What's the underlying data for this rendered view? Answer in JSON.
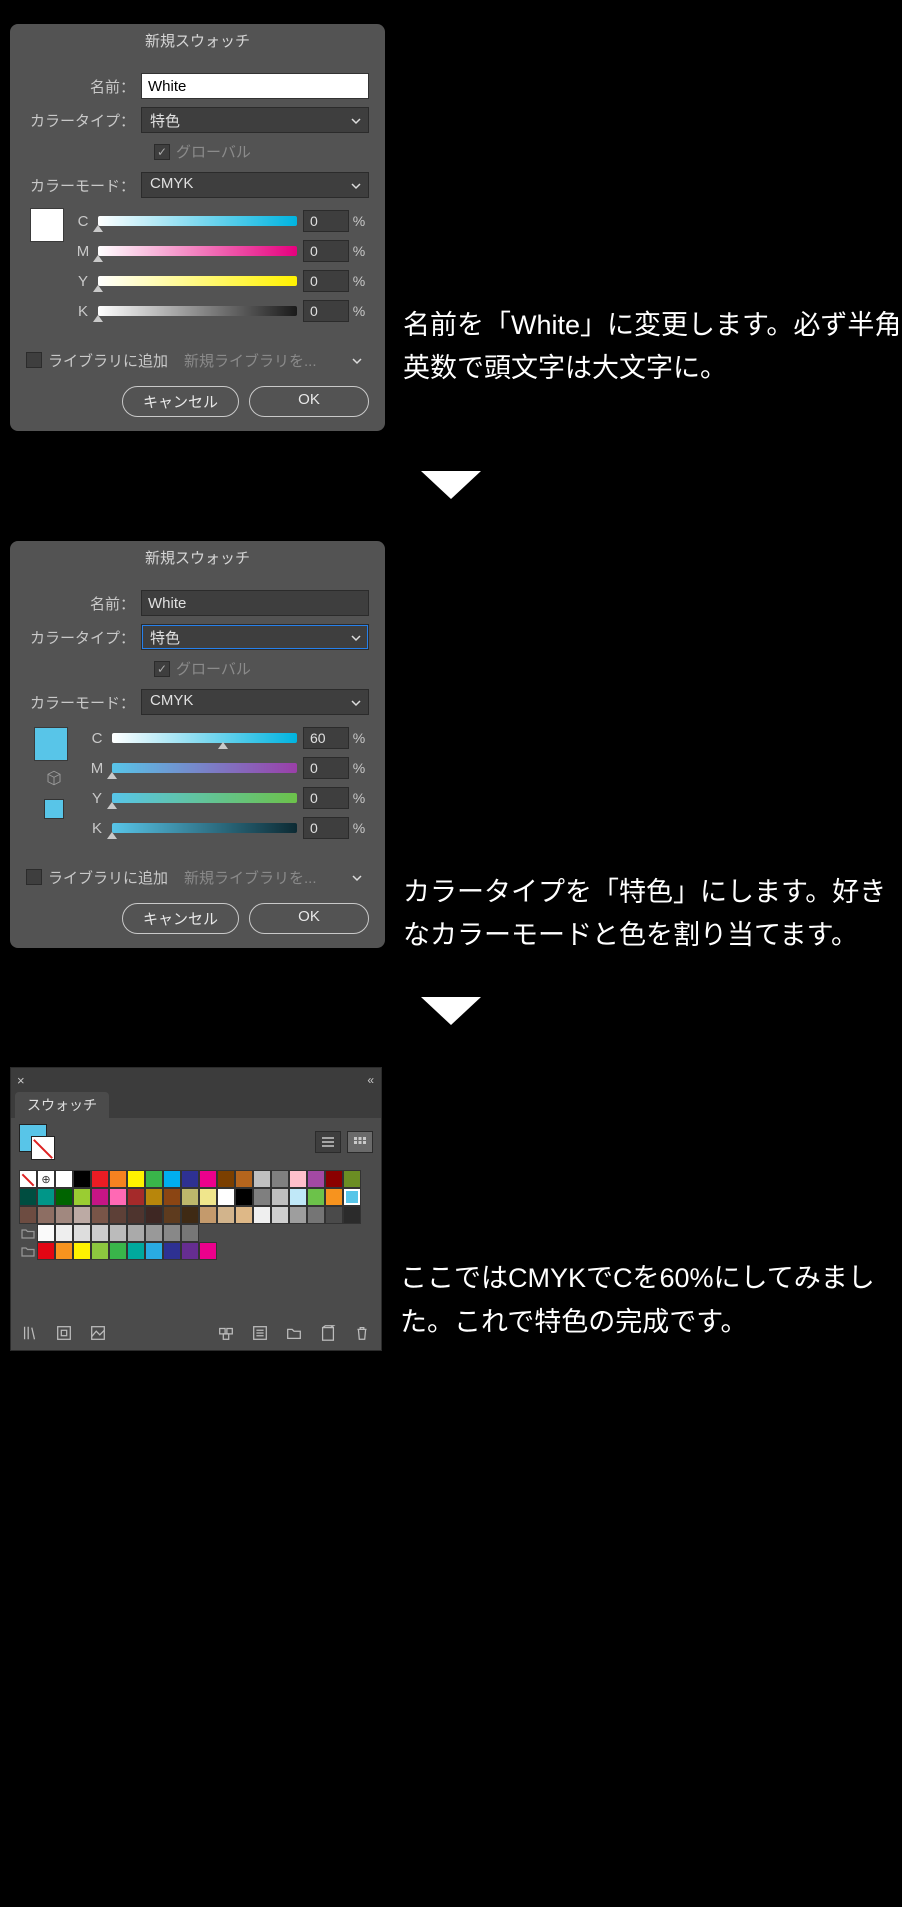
{
  "dialog1": {
    "title": "新規スウォッチ",
    "name_label": "名前：",
    "name_value": "White",
    "colortype_label": "カラータイプ：",
    "colortype_value": "特色",
    "global_label": "グローバル",
    "mode_label": "カラーモード：",
    "mode_value": "CMYK",
    "sliders": {
      "c": {
        "label": "C",
        "value": "0",
        "pct": "%"
      },
      "m": {
        "label": "M",
        "value": "0",
        "pct": "%"
      },
      "y": {
        "label": "Y",
        "value": "0",
        "pct": "%"
      },
      "k": {
        "label": "K",
        "value": "0",
        "pct": "%"
      }
    },
    "add_lib_label": "ライブラリに追加",
    "lib_placeholder": "新規ライブラリを...",
    "cancel": "キャンセル",
    "ok": "OK"
  },
  "caption1": "名前を「White」に変更します。必ず半角英数で頭文字は大文字に。",
  "dialog2": {
    "title": "新規スウォッチ",
    "name_label": "名前：",
    "name_value": "White",
    "colortype_label": "カラータイプ：",
    "colortype_value": "特色",
    "global_label": "グローバル",
    "mode_label": "カラーモード：",
    "mode_value": "CMYK",
    "sliders": {
      "c": {
        "label": "C",
        "value": "60",
        "pct": "%",
        "thumb_pct": 60
      },
      "m": {
        "label": "M",
        "value": "0",
        "pct": "%",
        "thumb_pct": 0
      },
      "y": {
        "label": "Y",
        "value": "0",
        "pct": "%",
        "thumb_pct": 0
      },
      "k": {
        "label": "K",
        "value": "0",
        "pct": "%",
        "thumb_pct": 0
      }
    },
    "add_lib_label": "ライブラリに追加",
    "lib_placeholder": "新規ライブラリを...",
    "cancel": "キャンセル",
    "ok": "OK"
  },
  "caption2": "カラータイプを「特色」にします。好きなカラーモードと色を割り当てます。",
  "panel": {
    "tab": "スウォッチ",
    "rows": [
      [
        "none",
        "reg",
        "#ffffff",
        "#000000",
        "#ec1c24",
        "#f58220",
        "#fff200",
        "#39b54a",
        "#00aeef",
        "#2e3192",
        "#ec008c",
        "#7b3f00",
        "#b5651d",
        "#c0c0c0",
        "#808080",
        "#ffc0cb",
        "#a349a4",
        "#8b0000",
        "#6b8e23"
      ],
      [
        "#004d40",
        "#009688",
        "#006400",
        "#9acd32",
        "#c71585",
        "#ff69b4",
        "#a52a2a",
        "#b8860b",
        "#8b4513",
        "#bdb76b",
        "#f0e68c",
        "#ffffff",
        "#000000",
        "#7f7f7f",
        "#bfbfbf",
        "#c0e8f8",
        "#6cc24a",
        "#f7931e",
        "#58c5e8"
      ],
      [
        "#6d4c41",
        "#8d6e63",
        "#a1887f",
        "#bcaaa4",
        "#795548",
        "#5d4037",
        "#4e342e",
        "#3e2723",
        "#5e3b1e",
        "#3f2a14",
        "#c49a6c",
        "#d2b48c",
        "#deb887",
        "#efefef",
        "#cfcfcf",
        "#9e9e9e",
        "#757575",
        "#4a4a4a",
        "#2b2b2b"
      ]
    ],
    "grays": [
      "#fafafa",
      "#eeeeee",
      "#dddddd",
      "#cccccc",
      "#bbbbbb",
      "#aaaaaa",
      "#999999",
      "#888888",
      "#777777"
    ],
    "brights": [
      "#e30613",
      "#f7931e",
      "#fff200",
      "#8cc63f",
      "#39b54a",
      "#00a99d",
      "#29abe2",
      "#2e3192",
      "#662d91",
      "#ec008c"
    ]
  },
  "caption3": "ここではCMYKでCを60%にしてみました。これで特色の完成です。"
}
